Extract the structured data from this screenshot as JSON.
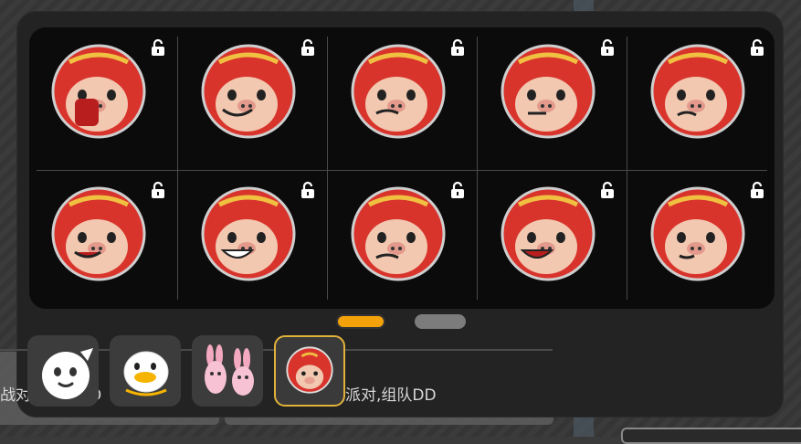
{
  "chat": {
    "left_text": "战对派组队DD",
    "right_text": "经典派对,组队DD"
  },
  "emoji_grid": {
    "items": [
      {
        "name": "shocked-pig",
        "locked": true
      },
      {
        "name": "heart-eyes-pig",
        "locked": true
      },
      {
        "name": "crying-flowers-pig",
        "locked": true
      },
      {
        "name": "gun-pig",
        "locked": true
      },
      {
        "name": "confused-pig",
        "locked": true
      },
      {
        "name": "smirk-pig",
        "locked": true
      },
      {
        "name": "peace-sign-pig",
        "locked": true
      },
      {
        "name": "sad-pig",
        "locked": true
      },
      {
        "name": "laughing-pig",
        "locked": true
      },
      {
        "name": "tied-up-pig",
        "locked": true
      }
    ]
  },
  "pagination": {
    "current": 1,
    "total": 2
  },
  "sticker_tabs": [
    {
      "name": "custom-face-tab",
      "selected": false
    },
    {
      "name": "duck-tab",
      "selected": false
    },
    {
      "name": "bunny-tab",
      "selected": false
    },
    {
      "name": "pig-tab",
      "selected": true
    }
  ],
  "colors": {
    "accent": "#f5a20a",
    "selected_border": "#e1b23a",
    "pig_red": "#d8342c",
    "pig_skin": "#f2c8b0"
  }
}
